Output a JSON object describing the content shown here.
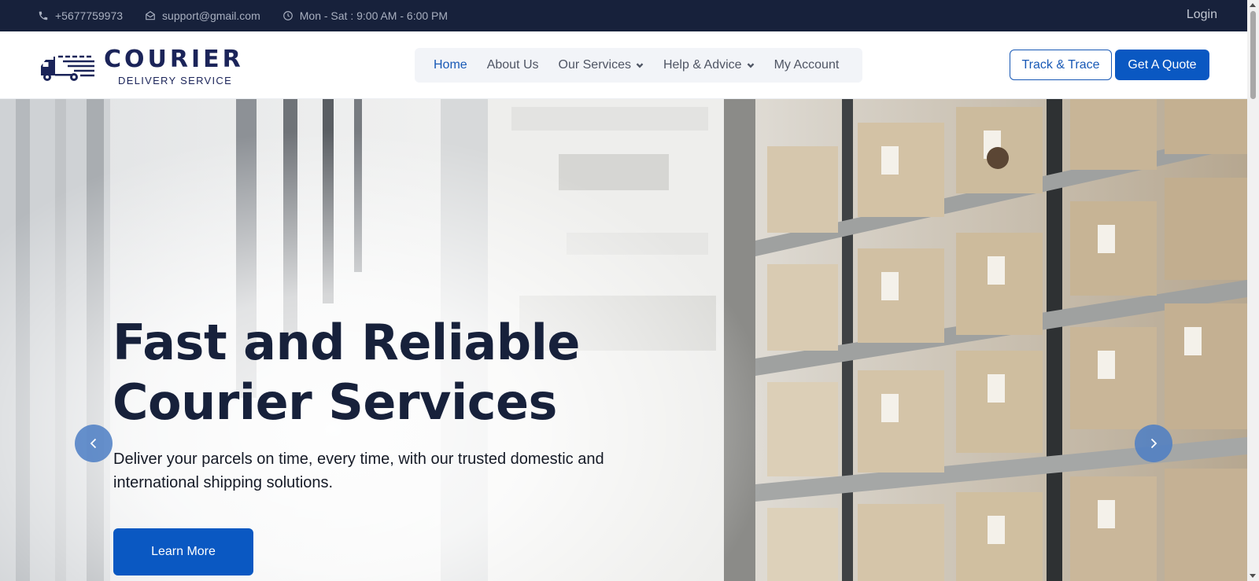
{
  "topbar": {
    "phone": "+5677759973",
    "email": "support@gmail.com",
    "hours": "Mon - Sat : 9:00 AM - 6:00 PM",
    "login_label": "Login"
  },
  "logo": {
    "brand": "COURIER",
    "tagline": "DELIVERY SERVICE"
  },
  "nav": {
    "items": [
      {
        "label": "Home",
        "active": true,
        "dropdown": false
      },
      {
        "label": "About Us",
        "active": false,
        "dropdown": false
      },
      {
        "label": "Our Services",
        "active": false,
        "dropdown": true
      },
      {
        "label": "Help & Advice",
        "active": false,
        "dropdown": true
      },
      {
        "label": "My Account",
        "active": false,
        "dropdown": false
      }
    ]
  },
  "actions": {
    "track_label": "Track & Trace",
    "quote_label": "Get A Quote"
  },
  "hero": {
    "title_line1": "Fast and Reliable",
    "title_line2": "Courier Services",
    "subtitle": "Deliver your parcels on time, every time, with our trusted domestic and international shipping solutions.",
    "cta_label": "Learn More",
    "background": "warehouse shelves with cardboard boxes"
  },
  "icons": {
    "phone": "phone-icon",
    "email": "envelope-icon",
    "hours": "clock-icon",
    "prev": "chevron-left-icon",
    "next": "chevron-right-icon",
    "dropdown": "chevron-down-icon"
  },
  "colors": {
    "topbar_bg": "#17213b",
    "primary": "#0a58c2",
    "heading": "#17213b",
    "nav_bg": "#f2f4f8",
    "nav_active": "#1859b6"
  }
}
